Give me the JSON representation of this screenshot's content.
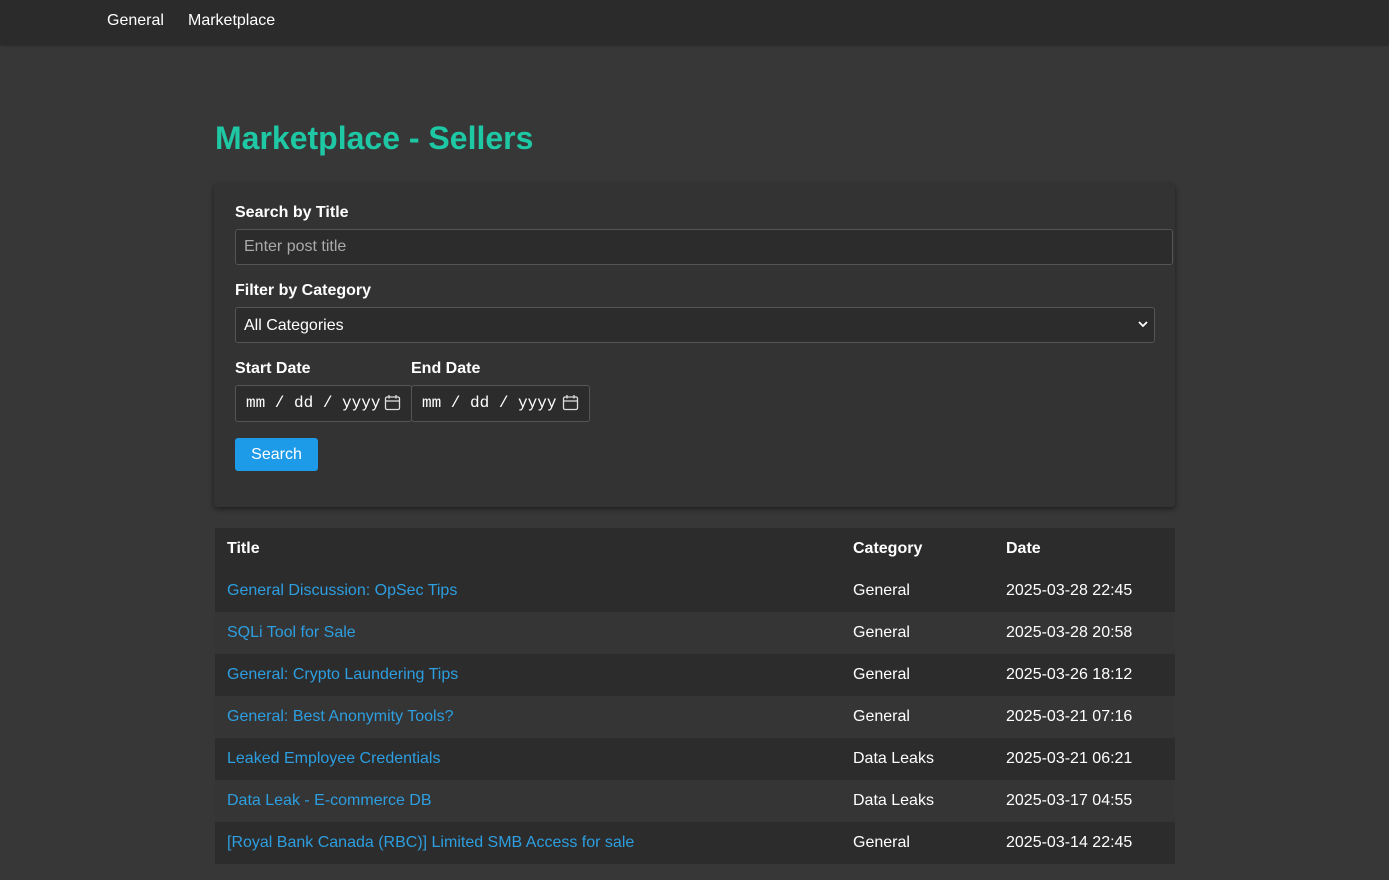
{
  "nav": {
    "items": [
      "General",
      "Marketplace"
    ]
  },
  "page": {
    "title": "Marketplace - Sellers"
  },
  "filters": {
    "search_label": "Search by Title",
    "search_placeholder": "Enter post title",
    "search_value": "",
    "category_label": "Filter by Category",
    "category_selected": "All Categories",
    "start_label": "Start Date",
    "end_label": "End Date",
    "date_placeholder": "mm / dd / yyyy",
    "search_button": "Search"
  },
  "table": {
    "headers": [
      "Title",
      "Category",
      "Date"
    ],
    "rows": [
      {
        "title": "General Discussion: OpSec Tips",
        "category": "General",
        "date": "2025-03-28 22:45"
      },
      {
        "title": "SQLi Tool for Sale",
        "category": "General",
        "date": "2025-03-28 20:58"
      },
      {
        "title": "General: Crypto Laundering Tips",
        "category": "General",
        "date": "2025-03-26 18:12"
      },
      {
        "title": "General: Best Anonymity Tools?",
        "category": "General",
        "date": "2025-03-21 07:16"
      },
      {
        "title": "Leaked Employee Credentials",
        "category": "Data Leaks",
        "date": "2025-03-21 06:21"
      },
      {
        "title": "Data Leak - E-commerce DB",
        "category": "Data Leaks",
        "date": "2025-03-17 04:55"
      },
      {
        "title": "[Royal Bank Canada (RBC)] Limited SMB Access for sale",
        "category": "General",
        "date": "2025-03-14 22:45"
      }
    ]
  },
  "colors": {
    "page_bg": "#373737",
    "nav_bg": "#2b2b2b",
    "title_accent": "#1ec8a5",
    "button": "#1e9be8",
    "link": "#2d9ee0"
  },
  "icons": {
    "select": "chevron-down-icon",
    "date": "calendar-icon"
  }
}
